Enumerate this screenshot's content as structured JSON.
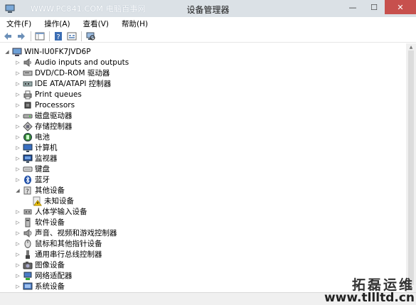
{
  "window": {
    "title": "设备管理器",
    "watermark_top": "WWW.PC841.COM 电脑百事网",
    "buttons": {
      "minimize": "—",
      "maximize": "☐",
      "close": "✕"
    }
  },
  "menu": [
    {
      "label": "文件(F)"
    },
    {
      "label": "操作(A)"
    },
    {
      "label": "查看(V)"
    },
    {
      "label": "帮助(H)"
    }
  ],
  "toolbar": [
    "back-icon",
    "forward-icon",
    "properties-pane-icon",
    "help-icon",
    "show-hidden-icon",
    "scan-hardware-icon"
  ],
  "tree": {
    "root": {
      "label": "WIN-IU0FK7JVD6P",
      "icon": "computer-icon",
      "expanded": true
    },
    "items": [
      {
        "label": "Audio inputs and outputs",
        "icon": "speaker-icon",
        "expanded": false
      },
      {
        "label": "DVD/CD-ROM 驱动器",
        "icon": "dvd-icon",
        "expanded": false
      },
      {
        "label": "IDE ATA/ATAPI 控制器",
        "icon": "ide-icon",
        "expanded": false
      },
      {
        "label": "Print queues",
        "icon": "printer-icon",
        "expanded": false
      },
      {
        "label": "Processors",
        "icon": "processor-icon",
        "expanded": false
      },
      {
        "label": "磁盘驱动器",
        "icon": "disk-icon",
        "expanded": false
      },
      {
        "label": "存储控制器",
        "icon": "storage-icon",
        "expanded": false
      },
      {
        "label": "电池",
        "icon": "battery-icon",
        "expanded": false
      },
      {
        "label": "计算机",
        "icon": "monitor-icon",
        "expanded": false
      },
      {
        "label": "监视器",
        "icon": "display-icon",
        "expanded": false
      },
      {
        "label": "键盘",
        "icon": "keyboard-icon",
        "expanded": false
      },
      {
        "label": "蓝牙",
        "icon": "bluetooth-icon",
        "expanded": false
      },
      {
        "label": "其他设备",
        "icon": "other-devices-icon",
        "expanded": true,
        "children": [
          {
            "label": "未知设备",
            "icon": "warning-device-icon"
          }
        ]
      },
      {
        "label": "人体学输入设备",
        "icon": "hid-icon",
        "expanded": false
      },
      {
        "label": "软件设备",
        "icon": "software-device-icon",
        "expanded": false
      },
      {
        "label": "声音、视频和游戏控制器",
        "icon": "sound-icon",
        "expanded": false
      },
      {
        "label": "鼠标和其他指针设备",
        "icon": "mouse-icon",
        "expanded": false
      },
      {
        "label": "通用串行总线控制器",
        "icon": "usb-icon",
        "expanded": false
      },
      {
        "label": "图像设备",
        "icon": "camera-icon",
        "expanded": false
      },
      {
        "label": "网络适配器",
        "icon": "network-icon",
        "expanded": false
      },
      {
        "label": "系统设备",
        "icon": "system-device-icon",
        "expanded": false
      }
    ]
  },
  "watermark_br": {
    "line1": "拓磊运维",
    "line2": "www.tllltd.cn"
  },
  "colors": {
    "title_bg": "#dbe1e6",
    "close_bg": "#c7504d",
    "status_bg": "#f0f0f0"
  }
}
